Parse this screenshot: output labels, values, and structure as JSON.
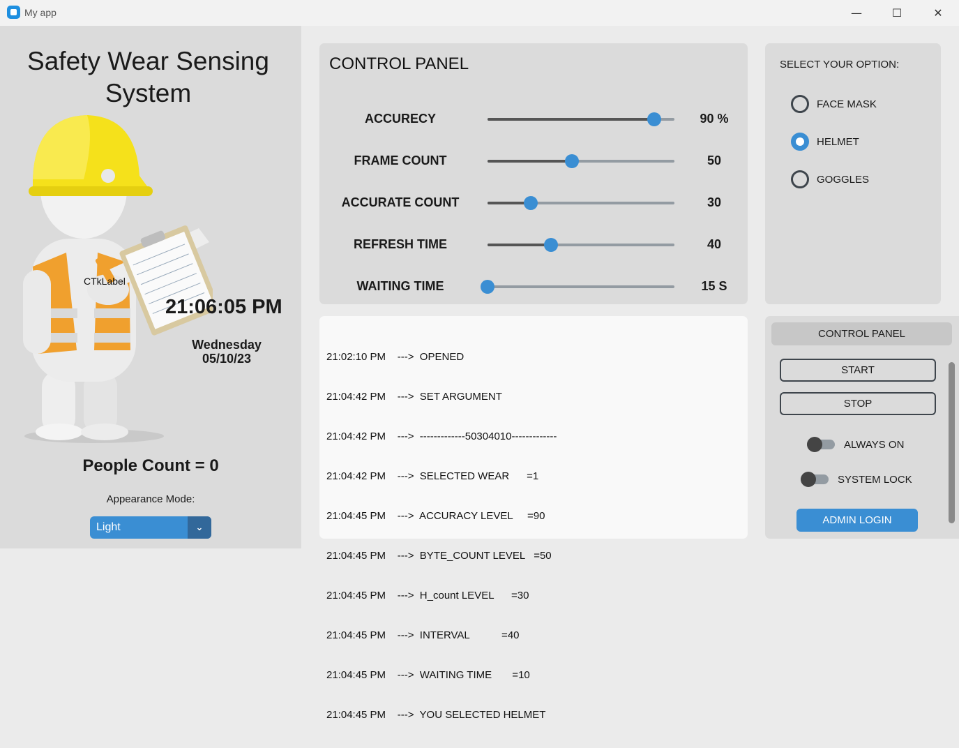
{
  "window": {
    "title": "My app",
    "controls": {
      "minimize": "—",
      "maximize": "☐",
      "close": "✕"
    }
  },
  "left": {
    "heading": "Safety Wear Sensing System",
    "image_label": "CTkLabel",
    "time": "21:06:05 PM",
    "day": "Wednesday",
    "date": "05/10/23",
    "people_count": "People Count = 0",
    "appearance_label": "Appearance Mode:",
    "appearance_value": "Light"
  },
  "control_panel": {
    "title": "CONTROL PANEL",
    "sliders": [
      {
        "label": "ACCURECY",
        "value_text": "90 %",
        "fraction": 0.89
      },
      {
        "label": "FRAME COUNT",
        "value_text": "50",
        "fraction": 0.45
      },
      {
        "label": "ACCURATE COUNT",
        "value_text": "30",
        "fraction": 0.23
      },
      {
        "label": "REFRESH TIME",
        "value_text": "40",
        "fraction": 0.34
      },
      {
        "label": "WAITING TIME",
        "value_text": "15 S",
        "fraction": 0.0
      }
    ]
  },
  "options": {
    "title": "SELECT YOUR OPTION:",
    "items": [
      {
        "label": "FACE MASK",
        "checked": false
      },
      {
        "label": "HELMET",
        "checked": true
      },
      {
        "label": "GOGGLES",
        "checked": false
      }
    ]
  },
  "log": {
    "lines": [
      "21:02:10 PM    --->  OPENED",
      "21:04:42 PM    --->  SET ARGUMENT",
      "21:04:42 PM    --->  -------------50304010-------------",
      "21:04:42 PM    --->  SELECTED WEAR      =1",
      "21:04:45 PM    --->  ACCURACY LEVEL     =90",
      "21:04:45 PM    --->  BYTE_COUNT LEVEL   =50",
      "21:04:45 PM    --->  H_count LEVEL      =30",
      "21:04:45 PM    --->  INTERVAL           =40",
      "21:04:45 PM    --->  WAITING TIME       =10",
      "21:04:45 PM    --->  YOU SELECTED HELMET"
    ]
  },
  "side_panel": {
    "header": "CONTROL PANEL",
    "start_label": "START",
    "stop_label": "STOP",
    "always_on_label": "ALWAYS ON",
    "system_lock_label": "SYSTEM LOCK",
    "admin_label": "ADMIN LOGIN"
  },
  "colors": {
    "accent": "#3a8ed3",
    "accent_dark": "#32689a",
    "panel": "#dbdbdb",
    "helmet": "#f5e11b",
    "vest": "#f0a02e"
  }
}
